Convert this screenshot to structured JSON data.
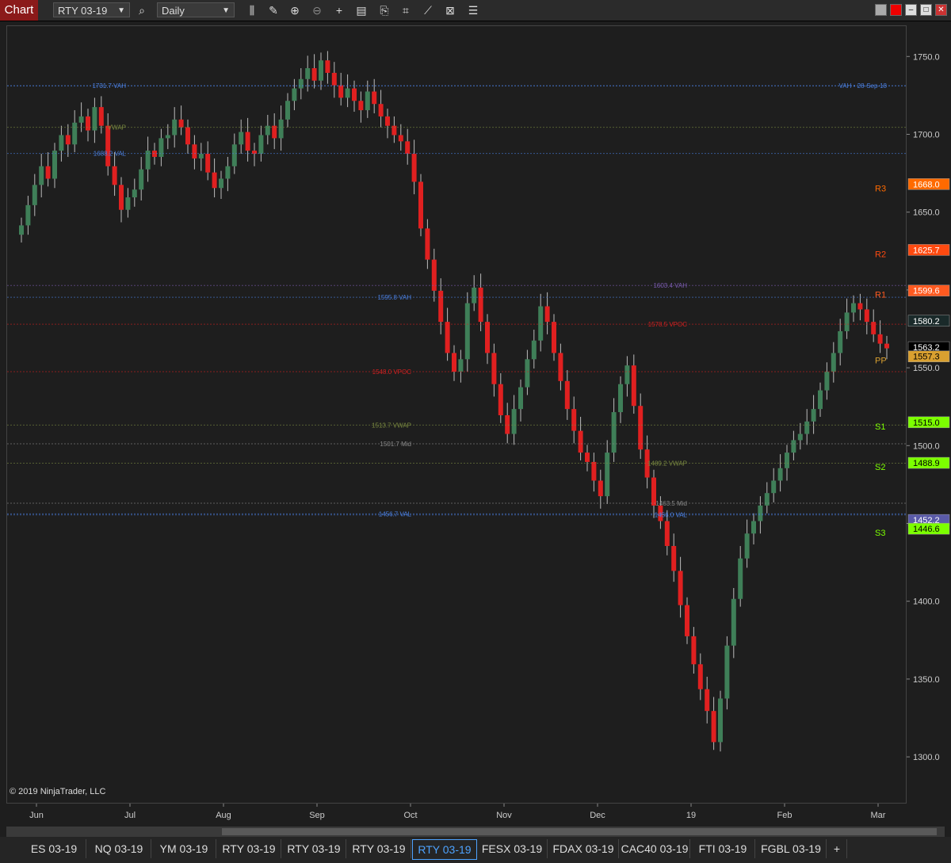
{
  "toolbar": {
    "chart_tab": "Chart",
    "instrument": "RTY 03-19",
    "interval": "Daily",
    "icons": [
      "search-icon",
      "bar-type-icon",
      "draw-pencil-icon",
      "zoom-in-icon",
      "zoom-out-icon",
      "crosshair-icon",
      "data-box-icon",
      "template-icon",
      "indicators-icon",
      "strategies-icon",
      "properties-icon",
      "more-icon"
    ]
  },
  "window_controls": [
    "color-swatch-icon",
    "link-red-icon",
    "minimize-icon",
    "maximize-icon",
    "close-icon"
  ],
  "copyright": "© 2019 NinjaTrader, LLC",
  "chart_data": {
    "type": "candlestick",
    "instrument": "RTY 03-19",
    "interval": "Daily",
    "ylim": [
      1270,
      1770
    ],
    "y_ticks": [
      1300.0,
      1350.0,
      1400.0,
      1450.0,
      1500.0,
      1550.0,
      1600.0,
      1650.0,
      1700.0,
      1750.0
    ],
    "y_tick_labels": [
      "1300.0",
      "1350.0",
      "1400.0",
      "1450.0",
      "1500.0",
      "1550.0",
      "1600.0",
      "1650.0",
      "1700.0",
      "1750.0"
    ],
    "x_tick_labels": [
      "Jun",
      "Jul",
      "Aug",
      "Sep",
      "Oct",
      "Nov",
      "Dec",
      "19",
      "Feb",
      "Mar"
    ],
    "colors": {
      "up": "#3f7f58",
      "down": "#e02020",
      "vah": "#4a7fe0",
      "vpoc": "#d02020",
      "vwap": "#7a8a40",
      "mid": "#888888",
      "sma": "#4a5a50",
      "vwap_line": "#5a5aa8"
    },
    "closes": [
      1642,
      1655,
      1668,
      1680,
      1672,
      1690,
      1700,
      1694,
      1708,
      1712,
      1703,
      1718,
      1706,
      1680,
      1668,
      1652,
      1660,
      1665,
      1678,
      1690,
      1686,
      1698,
      1700,
      1710,
      1705,
      1694,
      1685,
      1688,
      1676,
      1666,
      1672,
      1680,
      1694,
      1702,
      1690,
      1688,
      1700,
      1706,
      1698,
      1710,
      1722,
      1730,
      1736,
      1743,
      1735,
      1748,
      1740,
      1732,
      1724,
      1730,
      1722,
      1716,
      1728,
      1720,
      1712,
      1706,
      1700,
      1696,
      1688,
      1670,
      1640,
      1620,
      1600,
      1580,
      1560,
      1548,
      1556,
      1592,
      1602,
      1580,
      1560,
      1540,
      1520,
      1508,
      1524,
      1538,
      1556,
      1568,
      1590,
      1580,
      1560,
      1542,
      1524,
      1510,
      1496,
      1490,
      1478,
      1468,
      1496,
      1522,
      1540,
      1552,
      1526,
      1498,
      1480,
      1462,
      1452,
      1436,
      1420,
      1398,
      1378,
      1360,
      1344,
      1330,
      1310,
      1338,
      1372,
      1402,
      1428,
      1444,
      1452,
      1462,
      1470,
      1478,
      1486,
      1496,
      1504,
      1508,
      1516,
      1524,
      1536,
      1548,
      1560,
      1574,
      1586,
      1592,
      1588,
      1580,
      1572,
      1566,
      1563
    ],
    "current_price": "1563.2",
    "right_labels": [
      {
        "text": "1668.0",
        "price": 1668.0,
        "color": "#ff6a00"
      },
      {
        "text": "1625.7",
        "price": 1625.7,
        "color": "#ff4a10"
      },
      {
        "text": "1599.6",
        "price": 1599.6,
        "color": "#ff5a20"
      },
      {
        "text": "1580.2",
        "price": 1580.2,
        "color": "#1a2a2a"
      },
      {
        "text": "1563.2",
        "price": 1563.2,
        "color": "#000000"
      },
      {
        "text": "1557.3",
        "price": 1557.3,
        "color": "#d9a030"
      },
      {
        "text": "1515.0",
        "price": 1515.0,
        "color": "#7cff00"
      },
      {
        "text": "1488.9",
        "price": 1488.9,
        "color": "#7cff00"
      },
      {
        "text": "1452.2",
        "price": 1452.2,
        "color": "#5a5aa8"
      },
      {
        "text": "1446.6",
        "price": 1446.6,
        "color": "#7cff00"
      }
    ],
    "pivot_labels": [
      {
        "text": "R3",
        "price": 1668.0,
        "color": "#ff6a00"
      },
      {
        "text": "R2",
        "price": 1625.7,
        "color": "#ff4a10"
      },
      {
        "text": "R1",
        "price": 1599.6,
        "color": "#ff5a20"
      },
      {
        "text": "PP",
        "price": 1557.3,
        "color": "#d9a030"
      },
      {
        "text": "S1",
        "price": 1515.0,
        "color": "#7cff00"
      },
      {
        "text": "S2",
        "price": 1488.9,
        "color": "#7cff00"
      },
      {
        "text": "S3",
        "price": 1446.6,
        "color": "#7cff00"
      }
    ],
    "profile_labels": [
      {
        "text": "1731.7 VAH",
        "price": 1731.7,
        "color": "#4a7fe0"
      },
      {
        "text": "1688.2 VAL",
        "price": 1688.2,
        "color": "#4a7fe0"
      },
      {
        "text": "VWAP",
        "price": 1705.0,
        "color": "#7a8a40"
      },
      {
        "text": "1595.8 VAH",
        "price": 1595.8,
        "color": "#4a7fe0"
      },
      {
        "text": "1548.0 VPOC",
        "price": 1548.0,
        "color": "#d02020"
      },
      {
        "text": "1513.7 VWAP",
        "price": 1513.7,
        "color": "#7a8a40"
      },
      {
        "text": "1501.7 Mid",
        "price": 1501.7,
        "color": "#888888"
      },
      {
        "text": "1456.7 VAL",
        "price": 1456.7,
        "color": "#4a7fe0"
      },
      {
        "text": "1603.4 VAH",
        "price": 1603.4,
        "color": "#7a5ab0"
      },
      {
        "text": "1578.5 VPOC",
        "price": 1578.5,
        "color": "#d02020"
      },
      {
        "text": "1489.2 VWAP",
        "price": 1489.2,
        "color": "#7a8a40"
      },
      {
        "text": "1463.5 Mid",
        "price": 1463.5,
        "color": "#888888"
      },
      {
        "text": "1456.0 VAL",
        "price": 1456.0,
        "color": "#4a7fe0"
      },
      {
        "text": "VAH • 28-Sep-18",
        "price": 1731.7,
        "color": "#4a7fe0"
      }
    ]
  },
  "bottom_tabs": [
    {
      "label": "ES 03-19"
    },
    {
      "label": "NQ 03-19"
    },
    {
      "label": "YM 03-19"
    },
    {
      "label": "RTY 03-19"
    },
    {
      "label": "RTY 03-19"
    },
    {
      "label": "RTY 03-19"
    },
    {
      "label": "RTY 03-19",
      "active": true
    },
    {
      "label": "FESX 03-19"
    },
    {
      "label": "FDAX 03-19"
    },
    {
      "label": "CAC40 03-19"
    },
    {
      "label": "FTI 03-19"
    },
    {
      "label": "FGBL 03-19"
    }
  ],
  "add_tab": "+"
}
